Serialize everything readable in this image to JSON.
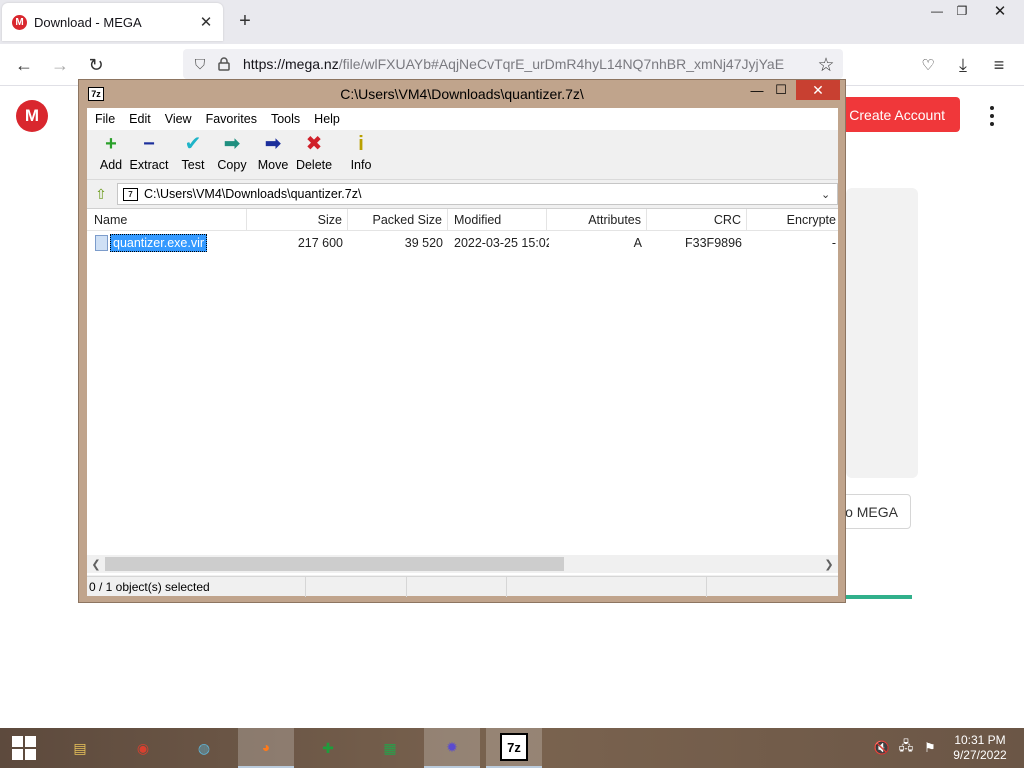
{
  "browser": {
    "tab_title": "Download - MEGA",
    "favicon_letter": "M",
    "url_host": "https://mega.nz",
    "url_path": "/file/wlFXUAYb#AqjNeCvTqrE_urDmR4hyL14NQ7nhBR_xmNj47JyjYaE"
  },
  "mega": {
    "logo_letter": "M",
    "create_account": "Create Account",
    "card_button": "o MEGA",
    "progress_fraction": 1.0,
    "accent_color": "#f0373a",
    "progress_color": "#31b08b"
  },
  "sevenzip": {
    "app_icon": "7z",
    "title": "C:\\Users\\VM4\\Downloads\\quantizer.7z\\",
    "menu": [
      "File",
      "Edit",
      "View",
      "Favorites",
      "Tools",
      "Help"
    ],
    "toolbar": [
      {
        "label": "Add",
        "icon": "plus-icon",
        "glyph": "+",
        "color": "#2aa02a"
      },
      {
        "label": "Extract",
        "icon": "minus-icon",
        "glyph": "−",
        "color": "#1c2f9c"
      },
      {
        "label": "Test",
        "icon": "check-icon",
        "glyph": "✔",
        "color": "#1fb4c8"
      },
      {
        "label": "Copy",
        "icon": "copy-arrow-icon",
        "glyph": "➡",
        "color": "#1f8f7f"
      },
      {
        "label": "Move",
        "icon": "move-arrow-icon",
        "glyph": "➡",
        "color": "#1c2f9c"
      },
      {
        "label": "Delete",
        "icon": "delete-x-icon",
        "glyph": "✖",
        "color": "#d0202a"
      },
      {
        "label": "Info",
        "icon": "info-icon",
        "glyph": "i",
        "color": "#b9a000"
      }
    ],
    "address": "C:\\Users\\VM4\\Downloads\\quantizer.7z\\",
    "columns": [
      "Name",
      "Size",
      "Packed Size",
      "Modified",
      "Attributes",
      "CRC",
      "Encrypte"
    ],
    "files": [
      {
        "name": "quantizer.exe.vir",
        "size": "217 600",
        "packed": "39 520",
        "modified": "2022-03-25 15:02",
        "attributes": "A",
        "crc": "F33F9896",
        "encrypted": "-"
      }
    ],
    "status": "0 / 1 object(s) selected"
  },
  "taskbar": {
    "apps": [
      {
        "name": "file-explorer",
        "glyph": "▤",
        "color": "#e8c25a"
      },
      {
        "name": "chrome",
        "glyph": "◉",
        "color": "#d8402f"
      },
      {
        "name": "network",
        "glyph": "◍",
        "color": "#5fb6d8"
      },
      {
        "name": "firefox",
        "glyph": "◕",
        "color": "#ff7a1a"
      },
      {
        "name": "games",
        "glyph": "✚",
        "color": "#1e9e3c"
      },
      {
        "name": "store",
        "glyph": "▦",
        "color": "#27a14a"
      },
      {
        "name": "settings",
        "glyph": "✹",
        "color": "#5a4bd0"
      },
      {
        "name": "7-zip",
        "glyph": "7z",
        "color": "#000000"
      }
    ],
    "time": "10:31 PM",
    "date": "9/27/2022"
  }
}
